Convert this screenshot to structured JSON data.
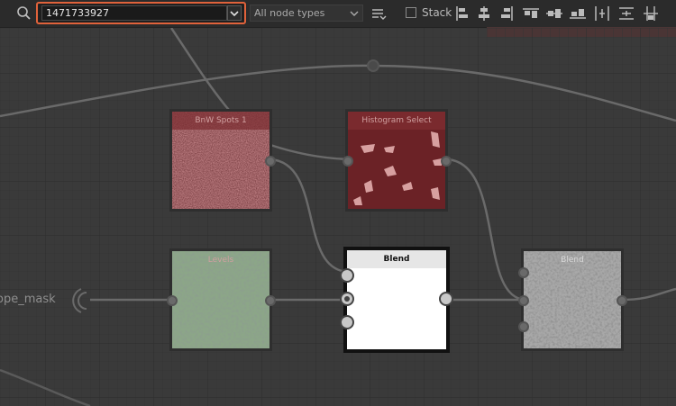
{
  "toolbar": {
    "search_value": "1471733927",
    "type_filter": "All node types",
    "stack_label": "Stack"
  },
  "nodes": {
    "bw_spots": "BnW Spots 1",
    "histogram": "Histogram Select",
    "levels": "Levels",
    "blend_selected": "Blend",
    "blend_right": "Blend"
  },
  "graph": {
    "input_label": "ope_mask"
  },
  "colors": {
    "accent": "#e0623b",
    "background": "#3a3a3a",
    "toolbar": "#2b2b2b"
  }
}
